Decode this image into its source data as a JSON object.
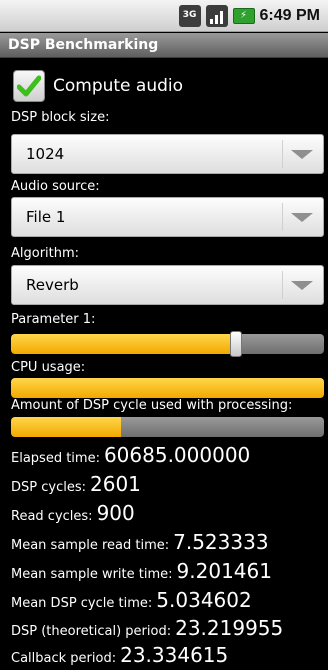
{
  "status_bar": {
    "network": "3G",
    "clock": "6:49 PM"
  },
  "title": "DSP Benchmarking",
  "compute_audio": {
    "label": "Compute audio",
    "checked": true
  },
  "block_size": {
    "label": "DSP block size:",
    "value": "1024"
  },
  "audio_source": {
    "label": "Audio source:",
    "value": "File 1"
  },
  "algorithm": {
    "label": "Algorithm:",
    "value": "Reverb"
  },
  "parameter1": {
    "label": "Parameter 1:",
    "level_percent": 72
  },
  "cpu_usage": {
    "label": "CPU usage:",
    "level_percent": 100
  },
  "dsp_cycle_usage": {
    "label": "Amount of DSP cycle used with processing:",
    "level_percent": 35
  },
  "stats": {
    "elapsed_time": {
      "label": "Elapsed time:",
      "value": "60685.000000"
    },
    "dsp_cycles": {
      "label": "DSP cycles:",
      "value": "2601"
    },
    "read_cycles": {
      "label": "Read cycles:",
      "value": "900"
    },
    "mean_read": {
      "label": "Mean sample read time:",
      "value": "7.523333"
    },
    "mean_write": {
      "label": "Mean sample write time:",
      "value": "9.201461"
    },
    "mean_dsp": {
      "label": "Mean DSP cycle time:",
      "value": "5.034602"
    },
    "dsp_period": {
      "label": "DSP (theoretical) period:",
      "value": "23.219955"
    },
    "callback_period": {
      "label": "Callback period:",
      "value": "23.334615"
    }
  },
  "colors": {
    "accent": "#f2a900",
    "check": "#3fbf1a",
    "battery": "#2fa12f"
  }
}
